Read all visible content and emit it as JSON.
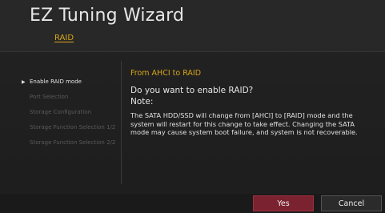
{
  "header": {
    "title": "EZ Tuning Wizard",
    "subtitle": "RAID"
  },
  "steps": [
    {
      "label": "Enable RAID mode",
      "active": true
    },
    {
      "label": "Port Selection",
      "active": false
    },
    {
      "label": "Storage Configuration",
      "active": false
    },
    {
      "label": "Storage Function Selection 1/2",
      "active": false
    },
    {
      "label": "Storage Function Selection 2/2",
      "active": false
    }
  ],
  "main": {
    "heading": "From AHCI to RAID",
    "question": "Do you want to enable RAID?",
    "note_label": "Note:",
    "note_text": "The SATA HDD/SSD will change from [AHCI] to [RAID] mode and the system will restart for this change to take effect. Changing the SATA mode may cause system boot failure, and system is not recoverable."
  },
  "buttons": {
    "yes": "Yes",
    "cancel": "Cancel"
  },
  "colors": {
    "accent": "#d7a51a",
    "primary_button": "#7a2230"
  },
  "icons": {
    "active_step_marker": "triangle-right-icon"
  }
}
